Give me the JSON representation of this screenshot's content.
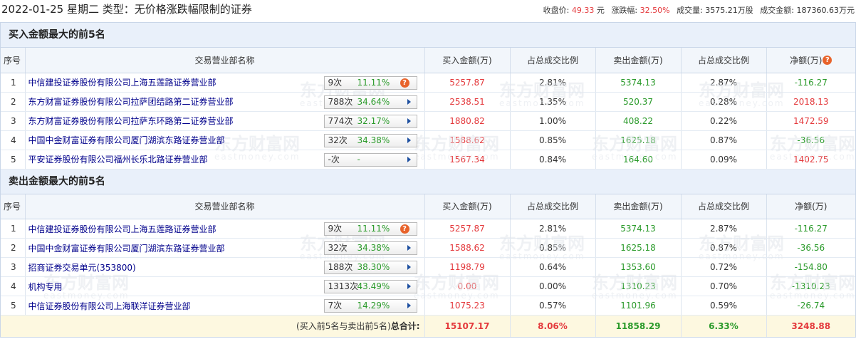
{
  "header": {
    "title": "2022-01-25 星期二 类型：无价格涨跌幅限制的证券",
    "close_label": "收盘价:",
    "close_value": "49.33",
    "close_unit": "元",
    "change_label": "涨跌幅:",
    "change_value": "32.50%",
    "volume_label": "成交量:",
    "volume_value": "3575.21万股",
    "turnover_label": "成交金额:",
    "turnover_value": "187360.63万元"
  },
  "columns": {
    "idx": "序号",
    "name": "交易营业部名称",
    "buy": "买入金额(万)",
    "buy_ratio": "占总成交比例",
    "sell": "卖出金额(万)",
    "sell_ratio": "占总成交比例",
    "net": "净额(万)"
  },
  "help_icon": "question-mark-icon",
  "buy_section": {
    "title": "买入金额最大的前5名",
    "rows": [
      {
        "idx": "1",
        "name": "中信建投证券股份有限公司上海五莲路证券营业部",
        "count": "9次",
        "rate": "11.11%",
        "icon": "question-mark-icon",
        "buy": "5257.87",
        "buy_ratio": "2.81%",
        "sell": "5374.13",
        "sell_ratio": "2.87%",
        "net": "-116.27",
        "net_sign": "neg"
      },
      {
        "idx": "2",
        "name": "东方财富证券股份有限公司拉萨团结路第二证券营业部",
        "count": "788次",
        "rate": "34.64%",
        "icon": "arrow-right-icon",
        "buy": "2538.51",
        "buy_ratio": "1.35%",
        "sell": "520.37",
        "sell_ratio": "0.28%",
        "net": "2018.13",
        "net_sign": "pos"
      },
      {
        "idx": "3",
        "name": "东方财富证券股份有限公司拉萨东环路第二证券营业部",
        "count": "774次",
        "rate": "32.17%",
        "icon": "arrow-right-icon",
        "buy": "1880.82",
        "buy_ratio": "1.00%",
        "sell": "408.22",
        "sell_ratio": "0.22%",
        "net": "1472.59",
        "net_sign": "pos"
      },
      {
        "idx": "4",
        "name": "中国中金财富证券有限公司厦门湖滨东路证券营业部",
        "count": "32次",
        "rate": "34.38%",
        "icon": "arrow-right-icon",
        "buy": "1588.62",
        "buy_ratio": "0.85%",
        "sell": "1625.18",
        "sell_ratio": "0.87%",
        "net": "-36.56",
        "net_sign": "neg"
      },
      {
        "idx": "5",
        "name": "平安证券股份有限公司福州长乐北路证券营业部",
        "count": "-次",
        "rate": "-",
        "icon": "arrow-right-icon",
        "buy": "1567.34",
        "buy_ratio": "0.84%",
        "sell": "164.60",
        "sell_ratio": "0.09%",
        "net": "1402.75",
        "net_sign": "pos"
      }
    ]
  },
  "sell_section": {
    "title": "卖出金额最大的前5名",
    "rows": [
      {
        "idx": "1",
        "name": "中信建投证券股份有限公司上海五莲路证券营业部",
        "count": "9次",
        "rate": "11.11%",
        "icon": "question-mark-icon",
        "buy": "5257.87",
        "buy_ratio": "2.81%",
        "sell": "5374.13",
        "sell_ratio": "2.87%",
        "net": "-116.27",
        "net_sign": "neg"
      },
      {
        "idx": "2",
        "name": "中国中金财富证券有限公司厦门湖滨东路证券营业部",
        "count": "32次",
        "rate": "34.38%",
        "icon": "arrow-right-icon",
        "buy": "1588.62",
        "buy_ratio": "0.85%",
        "sell": "1625.18",
        "sell_ratio": "0.87%",
        "net": "-36.56",
        "net_sign": "neg"
      },
      {
        "idx": "3",
        "name": "招商证券交易单元(353800)",
        "count": "188次",
        "rate": "38.30%",
        "icon": "arrow-right-icon",
        "buy": "1198.79",
        "buy_ratio": "0.64%",
        "sell": "1353.60",
        "sell_ratio": "0.72%",
        "net": "-154.80",
        "net_sign": "neg"
      },
      {
        "idx": "4",
        "name": "机构专用",
        "count": "1313次",
        "rate": "43.49%",
        "icon": "arrow-right-icon",
        "buy": "0.00",
        "buy_ratio": "0.00%",
        "sell": "1310.23",
        "sell_ratio": "0.70%",
        "net": "-1310.23",
        "net_sign": "neg"
      },
      {
        "idx": "5",
        "name": "中信证券股份有限公司上海联洋证券营业部",
        "count": "7次",
        "rate": "14.29%",
        "icon": "arrow-right-icon",
        "buy": "1075.23",
        "buy_ratio": "0.57%",
        "sell": "1101.96",
        "sell_ratio": "0.59%",
        "net": "-26.74",
        "net_sign": "neg"
      }
    ]
  },
  "totals": {
    "label_prefix": "(买入前5名与卖出前5名)",
    "label_bold": "总合计:",
    "buy": "15107.17",
    "buy_ratio": "8.06%",
    "sell": "11858.29",
    "sell_ratio": "6.33%",
    "net": "3248.88"
  },
  "watermark": {
    "cn": "东方财富网",
    "en": "eastmoney.com"
  },
  "colors": {
    "up": "#e4393c",
    "down": "#2a9a2a",
    "header_bg": "#e9f0fa",
    "total_bg": "#fdf8e0",
    "help_icon": "#e8632b",
    "arrow": "#1d4fa0"
  }
}
